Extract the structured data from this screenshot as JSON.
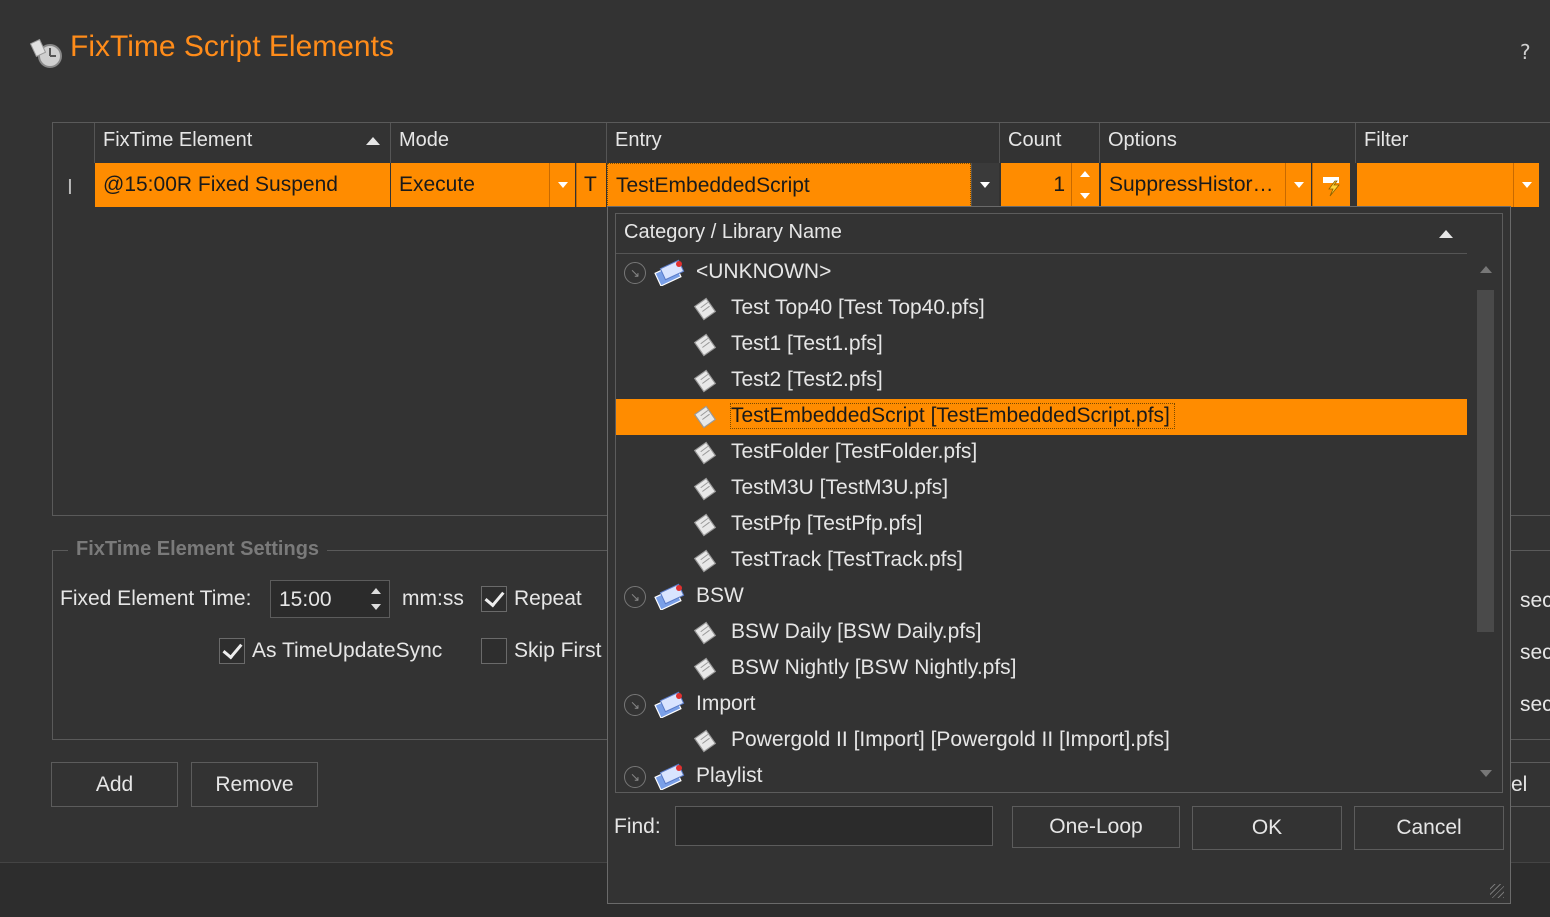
{
  "window": {
    "title": "FixTime Script Elements",
    "help": "?"
  },
  "grid": {
    "headers": {
      "element": "FixTime Element",
      "mode": "Mode",
      "entry": "Entry",
      "count": "Count",
      "options": "Options",
      "filter": "Filter"
    },
    "row": {
      "marker": "I",
      "element": "@15:00R Fixed Suspend",
      "mode": "Execute",
      "t_flag": "T",
      "entry": "TestEmbeddedScript",
      "count": "1",
      "options": "SuppressHistor…",
      "filter": ""
    }
  },
  "settings": {
    "group_label": "FixTime Element Settings",
    "fixed_time_label": "Fixed Element Time:",
    "fixed_time_value": "15:00",
    "fixed_time_unit": "mm:ss",
    "repeat_label": "Repeat",
    "repeat_checked": true,
    "time_sync_label": "As TimeUpdateSync",
    "time_sync_checked": true,
    "skip_first_label": "Skip First",
    "skip_first_checked": false,
    "sec_labels": [
      "sec",
      "sec",
      "sec"
    ]
  },
  "buttons": {
    "add": "Add",
    "remove": "Remove",
    "hidden_right": "el"
  },
  "popup": {
    "header": "Category / Library Name",
    "tree": [
      {
        "label": "<UNKNOWN>",
        "level": 0,
        "selected": false
      },
      {
        "label": "Test Top40 [Test Top40.pfs]",
        "level": 1,
        "selected": false
      },
      {
        "label": "Test1 [Test1.pfs]",
        "level": 1,
        "selected": false
      },
      {
        "label": "Test2 [Test2.pfs]",
        "level": 1,
        "selected": false
      },
      {
        "label": "TestEmbeddedScript [TestEmbeddedScript.pfs]",
        "level": 1,
        "selected": true
      },
      {
        "label": "TestFolder [TestFolder.pfs]",
        "level": 1,
        "selected": false
      },
      {
        "label": "TestM3U [TestM3U.pfs]",
        "level": 1,
        "selected": false
      },
      {
        "label": "TestPfp [TestPfp.pfs]",
        "level": 1,
        "selected": false
      },
      {
        "label": "TestTrack [TestTrack.pfs]",
        "level": 1,
        "selected": false
      },
      {
        "label": "BSW",
        "level": 0,
        "selected": false
      },
      {
        "label": "BSW Daily [BSW Daily.pfs]",
        "level": 1,
        "selected": false
      },
      {
        "label": "BSW Nightly [BSW Nightly.pfs]",
        "level": 1,
        "selected": false
      },
      {
        "label": "Import",
        "level": 0,
        "selected": false
      },
      {
        "label": "Powergold II [Import] [Powergold II [Import].pfs]",
        "level": 1,
        "selected": false
      },
      {
        "label": "Playlist",
        "level": 0,
        "selected": false
      }
    ],
    "find_label": "Find:",
    "find_value": "",
    "one_loop": "One-Loop",
    "ok": "OK",
    "cancel": "Cancel"
  },
  "colors": {
    "accent": "#ff8c00",
    "title": "#ff8c1a",
    "background": "#333333"
  }
}
